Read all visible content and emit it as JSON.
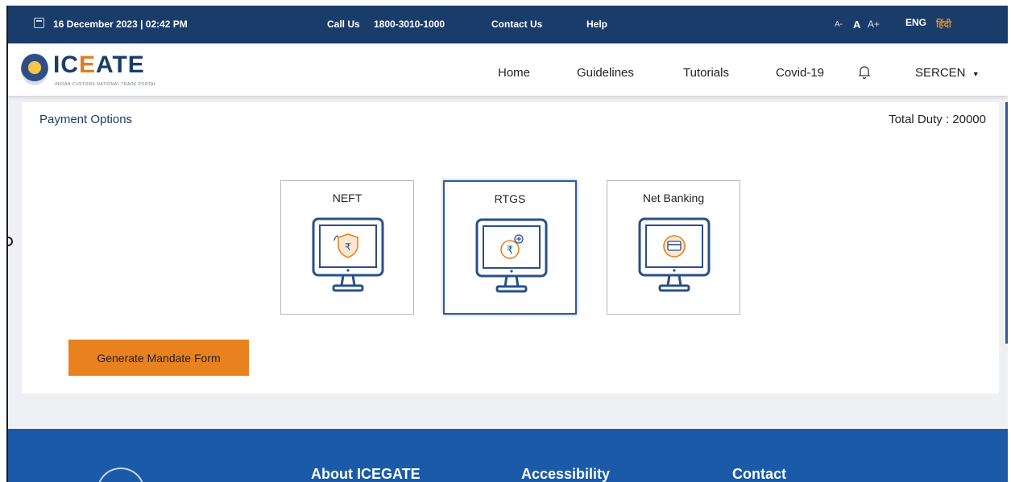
{
  "topbar": {
    "datetime": "16 December 2023 | 02:42 PM",
    "call_label": "Call Us",
    "phone": "1800-3010-1000",
    "contact_us": "Contact Us",
    "help": "Help",
    "font_small": "A-",
    "font_normal": "A",
    "font_large": "A+",
    "lang_en": "ENG",
    "lang_hi": "हिंदी"
  },
  "header": {
    "logo_text_prefix": "IC",
    "logo_text_accent": "E",
    "logo_text_suffix": "ATE",
    "logo_tagline": "INDIAN CUSTOMS NATIONAL TRADE PORTAL",
    "nav": [
      "Home",
      "Guidelines",
      "Tutorials",
      "Covid-19"
    ],
    "user": "SERCEN"
  },
  "payment": {
    "title": "Payment Options",
    "total_duty": "Total Duty : 20000",
    "options": [
      {
        "label": "NEFT",
        "icon": "neft-shield-rupee-icon",
        "selected": false
      },
      {
        "label": "RTGS",
        "icon": "rtgs-rupee-plus-icon",
        "selected": true
      },
      {
        "label": "Net Banking",
        "icon": "netbanking-card-icon",
        "selected": false
      }
    ],
    "generate_button": "Generate Mandate Form"
  },
  "footer": {
    "headings": [
      "About ICEGATE",
      "Accessibility",
      "Contact"
    ]
  },
  "colors": {
    "primary_navy": "#1a3c6b",
    "footer_blue": "#1a5aa8",
    "accent_orange": "#e8821f",
    "selected_border": "#2f5aa0"
  }
}
